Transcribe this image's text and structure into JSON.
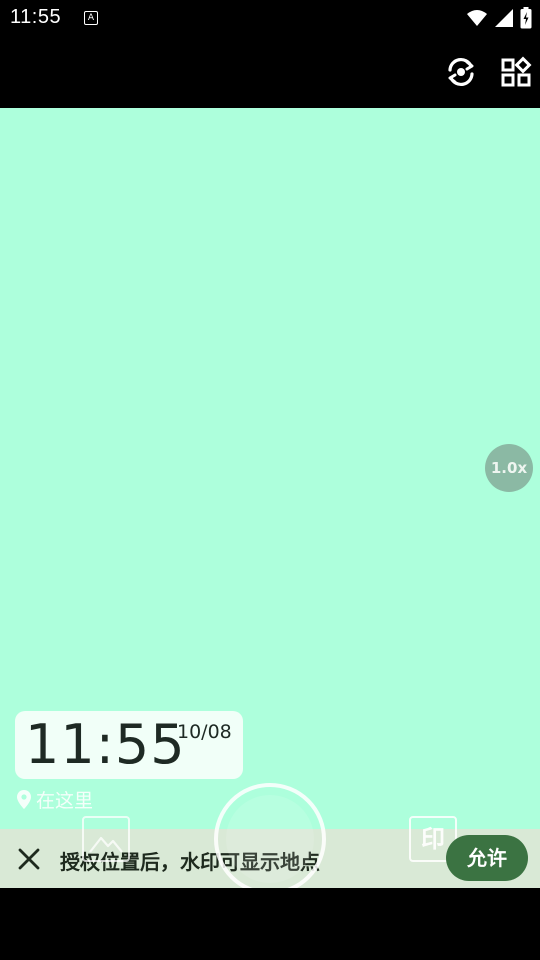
{
  "status_bar": {
    "time": "11:55",
    "notification_badge": "A"
  },
  "top_bar": {
    "switch_camera_icon": "flip-camera-icon",
    "more_icon": "apps-grid-icon"
  },
  "viewfinder": {
    "background_color": "#adffdc",
    "zoom_label": "1.0x"
  },
  "watermark": {
    "time": "11:55",
    "date": "10/08",
    "location": "在这里"
  },
  "location_banner": {
    "message": "授权位置后，水印可显示地点",
    "allow_label": "允许"
  },
  "bottom_controls": {
    "watermark_button_label": "印"
  },
  "colors": {
    "accent": "#3b7342",
    "banner_bg": "#d9e9d6",
    "zoom_bg": "#8bb9a4"
  }
}
